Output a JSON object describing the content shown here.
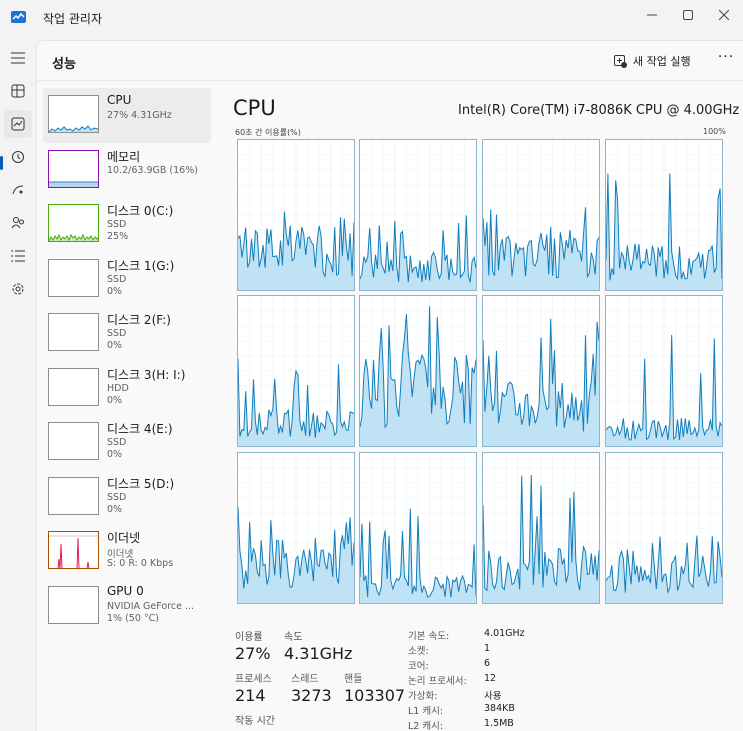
{
  "window": {
    "title": "작업 관리자"
  },
  "header": {
    "title": "성능",
    "new_task_label": "새 작업 실행",
    "more_label": "···"
  },
  "nav": [
    "menu-icon",
    "processes-icon",
    "performance-icon",
    "app-history-icon",
    "startup-icon",
    "users-icon",
    "details-icon",
    "services-icon"
  ],
  "resources": [
    {
      "name": "CPU",
      "sub1": "27% 4.31GHz",
      "sub2": ""
    },
    {
      "name": "메모리",
      "sub1": "10.2/63.9GB (16%)",
      "sub2": ""
    },
    {
      "name": "디스크 0(C:)",
      "sub1": "SSD",
      "sub2": "25%"
    },
    {
      "name": "디스크 1(G:)",
      "sub1": "SSD",
      "sub2": "0%"
    },
    {
      "name": "디스크 2(F:)",
      "sub1": "SSD",
      "sub2": "0%"
    },
    {
      "name": "디스크 3(H: I:)",
      "sub1": "HDD",
      "sub2": "0%"
    },
    {
      "name": "디스크 4(E:)",
      "sub1": "SSD",
      "sub2": "0%"
    },
    {
      "name": "디스크 5(D:)",
      "sub1": "SSD",
      "sub2": "0%"
    },
    {
      "name": "이더넷",
      "sub1": "이더넷",
      "sub2": "S: 0 R: 0 Kbps"
    },
    {
      "name": "GPU 0",
      "sub1": "NVIDIA GeForce ...",
      "sub2": "1% (50 °C)"
    }
  ],
  "cpu": {
    "title": "CPU",
    "model": "Intel(R) Core(TM) i7-8086K CPU @ 4.00GHz",
    "graph_label": "60초 간 이용률(%)",
    "graph_max": "100%",
    "stats": {
      "util_label": "이용률",
      "util_value": "27%",
      "speed_label": "속도",
      "speed_value": "4.31GHz",
      "proc_label": "프로세스",
      "proc_value": "214",
      "thread_label": "스레드",
      "thread_value": "3273",
      "handle_label": "핸들",
      "handle_value": "103307",
      "uptime_label": "작동 시간"
    },
    "specs": [
      {
        "k": "기본 속도:",
        "v": "4.01GHz"
      },
      {
        "k": "소켓:",
        "v": "1"
      },
      {
        "k": "코어:",
        "v": "6"
      },
      {
        "k": "논리 프로세서:",
        "v": "12"
      },
      {
        "k": "가상화:",
        "v": "사용"
      },
      {
        "k": "L1 캐시:",
        "v": "384KB"
      },
      {
        "k": "L2 캐시:",
        "v": "1.5MB"
      }
    ]
  },
  "colors": {
    "accent": "#005fb8",
    "cpu_line": "#117dbb",
    "cpu_fill": "#bfe3f4",
    "mem_line": "#8b12ae",
    "disk_line": "#4da60c",
    "net_line": "#a74f01"
  }
}
